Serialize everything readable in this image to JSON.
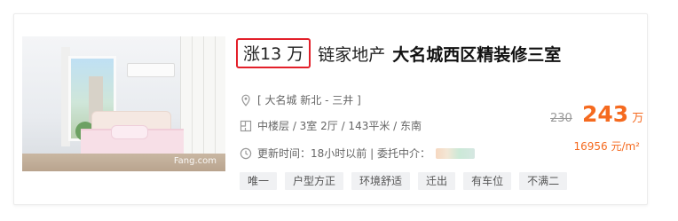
{
  "listing": {
    "price_change": "涨13 万",
    "agency": "链家地产",
    "estate_title": "大名城西区精装修三室",
    "location": "[ 大名城 新北 - 三井 ]",
    "layout_info": "中楼层 / 3室 2厅 / 143平米 / 东南",
    "update_info": "更新时间：18小时以前 | 委托中介：",
    "photo_watermark": "Fang.com",
    "tags": [
      "唯一",
      "户型方正",
      "环境舒适",
      "迁出",
      "有车位",
      "不满二"
    ],
    "old_price": "230",
    "price": "243",
    "price_unit": "万",
    "unit_price": "16956 元/m²"
  },
  "colors": {
    "highlight_border": "#e3202a",
    "price": "#f56a1f",
    "tag_bg": "#f0f1f3"
  },
  "icons": {
    "location": "location-pin-icon",
    "layout": "floorplan-icon",
    "time": "clock-icon"
  }
}
